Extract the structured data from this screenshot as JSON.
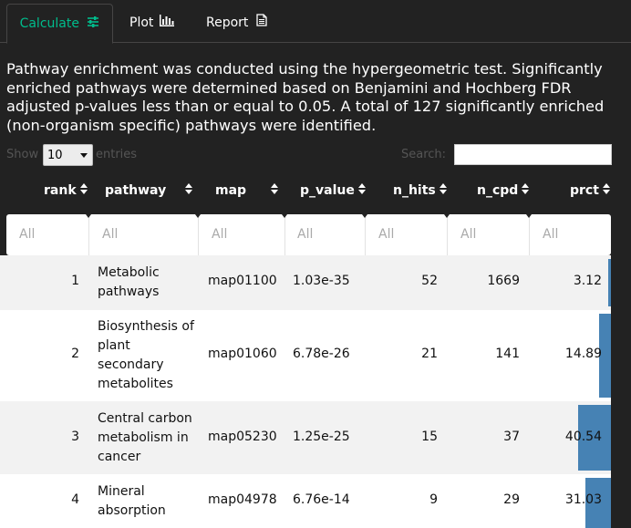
{
  "tabs": [
    {
      "label": "Calculate",
      "icon": "sliders-icon",
      "active": true
    },
    {
      "label": "Plot",
      "icon": "bar-chart-icon",
      "active": false
    },
    {
      "label": "Report",
      "icon": "document-icon",
      "active": false
    }
  ],
  "description": "Pathway enrichment was conducted using the hypergeometric test. Significantly enriched pathways were determined based on Benjamini and Hochberg FDR adjusted p-values less than or equal to 0.05. A total of 127 significantly enriched (non-organism specific) pathways were identified.",
  "controls": {
    "show_label": "Show",
    "entries_label": "entries",
    "length_value": "10",
    "search_label": "Search:",
    "search_value": ""
  },
  "table": {
    "columns": [
      "rank",
      "pathway",
      "map",
      "p_value",
      "n_hits",
      "n_cpd",
      "prct"
    ],
    "filter_placeholder": "All",
    "rows": [
      {
        "rank": "1",
        "pathway_lines": [
          "Metabolic",
          "pathways"
        ],
        "map": "map01100",
        "p_value": "1.03e-35",
        "n_hits": "52",
        "n_cpd": "1669",
        "prct": "3.12",
        "prct_value": 3.12
      },
      {
        "rank": "2",
        "pathway_lines": [
          "Biosynthesis of",
          "plant",
          "secondary",
          "metabolites"
        ],
        "map": "map01060",
        "p_value": "6.78e-26",
        "n_hits": "21",
        "n_cpd": "141",
        "prct": "14.89",
        "prct_value": 14.89
      },
      {
        "rank": "3",
        "pathway_lines": [
          "Central carbon",
          "metabolism in",
          "cancer"
        ],
        "map": "map05230",
        "p_value": "1.25e-25",
        "n_hits": "15",
        "n_cpd": "37",
        "prct": "40.54",
        "prct_value": 40.54
      },
      {
        "rank": "4",
        "pathway_lines": [
          "Mineral",
          "absorption"
        ],
        "map": "map04978",
        "p_value": "6.76e-14",
        "n_hits": "9",
        "n_cpd": "29",
        "prct": "31.03",
        "prct_value": 31.03
      }
    ]
  },
  "colors": {
    "accent": "#00bc8c",
    "bar": "#4682b4",
    "background": "#222222"
  }
}
